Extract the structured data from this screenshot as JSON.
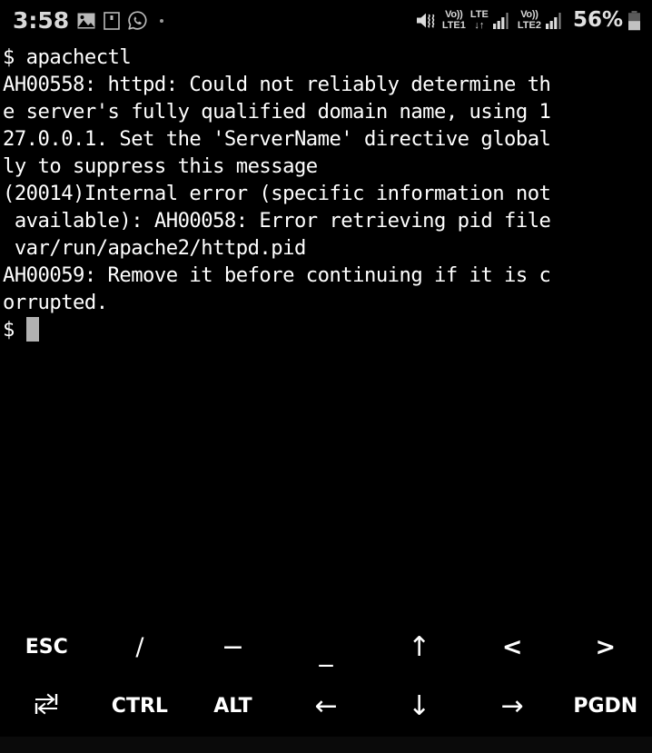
{
  "status_bar": {
    "clock": "3:58",
    "left_icons": [
      {
        "name": "gallery-icon",
        "label": "Gallery"
      },
      {
        "name": "screenshot-icon",
        "label": "Screenshot"
      },
      {
        "name": "whatsapp-icon",
        "label": "WhatsApp"
      },
      {
        "name": "more-notifications-dot",
        "label": "More notifications"
      }
    ],
    "mute_icon": "vibrate-mute-icon",
    "sim1": {
      "volte": "Vo))",
      "network": "LTE1"
    },
    "data": {
      "type": "LTE",
      "arrows": "↓↑"
    },
    "sim2": {
      "volte": "Vo))",
      "network": "LTE2"
    },
    "signal_bars_1": 4,
    "signal_bars_2": 4,
    "battery_percent": "56%",
    "battery_level": 56,
    "colors": {
      "text": "#d8d8d8",
      "background": "#000000"
    }
  },
  "terminal": {
    "background": "#000000",
    "foreground": "#ffffff",
    "cursor_color": "#b2b2b2",
    "lines": [
      "$ apachectl",
      "AH00558: httpd: Could not reliably determine th",
      "e server's fully qualified domain name, using 1",
      "27.0.0.1. Set the 'ServerName' directive global",
      "ly to suppress this message",
      "(20014)Internal error (specific information not",
      " available): AH00058: Error retrieving pid file",
      " var/run/apache2/httpd.pid",
      "AH00059: Remove it before continuing if it is c",
      "orrupted."
    ],
    "prompt": "$ "
  },
  "key_bar": {
    "row1": [
      {
        "name": "key-esc",
        "label": "ESC",
        "style": "label-sm"
      },
      {
        "name": "key-slash",
        "label": "/",
        "style": "glyph"
      },
      {
        "name": "key-dash",
        "label": "−",
        "style": "dash"
      },
      {
        "name": "key-underscore",
        "label": "_",
        "style": "underscore"
      },
      {
        "name": "key-arrow-up",
        "label": "↑",
        "style": "arrow"
      },
      {
        "name": "key-less-than",
        "label": "<",
        "style": "angle"
      },
      {
        "name": "key-greater-than",
        "label": ">",
        "style": "angle"
      }
    ],
    "row2": [
      {
        "name": "key-tab",
        "label": "",
        "style": "tab-icon"
      },
      {
        "name": "key-ctrl",
        "label": "CTRL",
        "style": "label-sm"
      },
      {
        "name": "key-alt",
        "label": "ALT",
        "style": "label-sm"
      },
      {
        "name": "key-arrow-left",
        "label": "←",
        "style": "arrow"
      },
      {
        "name": "key-arrow-down",
        "label": "↓",
        "style": "arrow"
      },
      {
        "name": "key-arrow-right",
        "label": "→",
        "style": "arrow"
      },
      {
        "name": "key-pgdn",
        "label": "PGDN",
        "style": "label-sm"
      }
    ]
  }
}
